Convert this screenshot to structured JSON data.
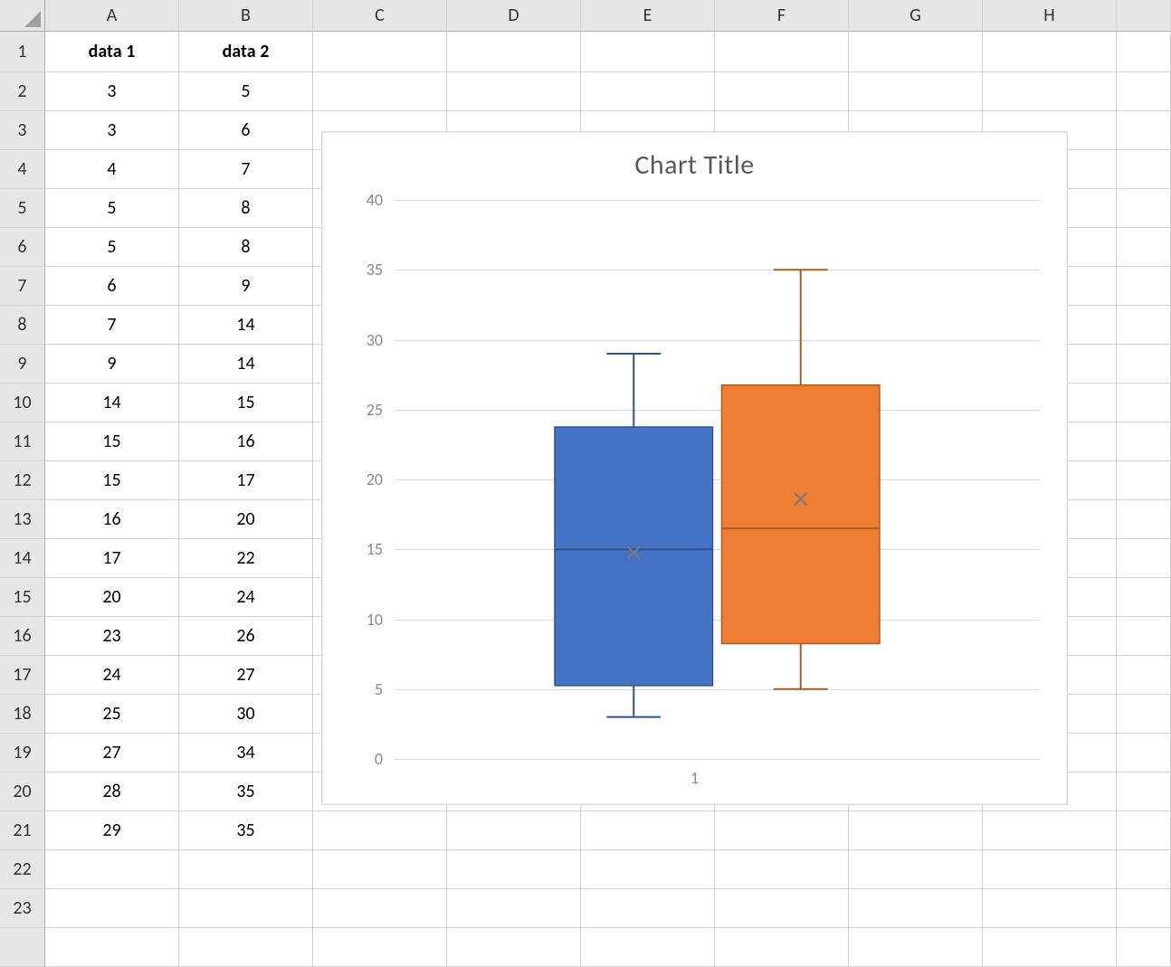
{
  "columns": [
    "A",
    "B",
    "C",
    "D",
    "E",
    "F",
    "G",
    "H"
  ],
  "row_count": 24,
  "table": {
    "headers": [
      "data 1",
      "data 2"
    ],
    "rows": [
      [
        3,
        5
      ],
      [
        3,
        6
      ],
      [
        4,
        7
      ],
      [
        5,
        8
      ],
      [
        5,
        8
      ],
      [
        6,
        9
      ],
      [
        7,
        14
      ],
      [
        9,
        14
      ],
      [
        14,
        15
      ],
      [
        15,
        16
      ],
      [
        15,
        17
      ],
      [
        16,
        20
      ],
      [
        17,
        22
      ],
      [
        20,
        24
      ],
      [
        23,
        26
      ],
      [
        24,
        27
      ],
      [
        25,
        30
      ],
      [
        27,
        34
      ],
      [
        28,
        35
      ],
      [
        29,
        35
      ]
    ]
  },
  "chart_data": {
    "type": "box",
    "title": "Chart Title",
    "x_category_label": "1",
    "ylim": [
      0,
      40
    ],
    "yticks": [
      0,
      5,
      10,
      15,
      20,
      25,
      30,
      35,
      40
    ],
    "series": [
      {
        "name": "data 1",
        "color": "#4472c4",
        "min": 3,
        "q1": 5.25,
        "median": 15,
        "mean": 14.75,
        "q3": 23.75,
        "max": 29
      },
      {
        "name": "data 2",
        "color": "#ed7d31",
        "min": 5,
        "q1": 8.25,
        "median": 16.5,
        "mean": 18.6,
        "q3": 26.75,
        "max": 35
      }
    ]
  }
}
